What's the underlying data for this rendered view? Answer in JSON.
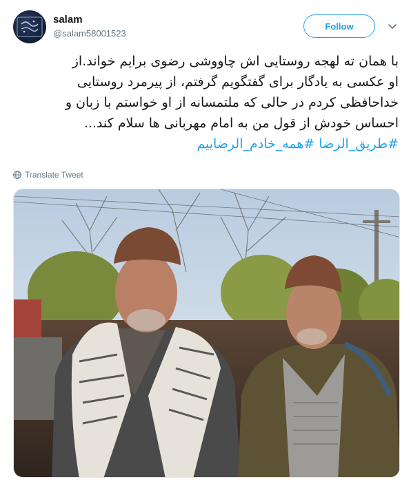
{
  "user": {
    "display_name": "salam",
    "handle": "@salam58001523"
  },
  "actions": {
    "follow_label": "Follow"
  },
  "tweet": {
    "lines": [
      "با همان ته لهجه روستایی اش چاووشی رضوی برایم خواند.از",
      "او عکسی به یادگار برای گفتگویم گرفتم، از پیرمرد روستایی",
      "خداحافظی کردم در حالی که ملتمسانه از او خواستم با زبان و",
      "احساس خودش از قول من به امام مهربانی ها سلام کند..."
    ],
    "hashtags": [
      "#طریق_الرضا",
      "#همه_خادم_الرضاییم"
    ]
  },
  "translate_label": "Translate Tweet",
  "colors": {
    "accent": "#1da1f2",
    "secondary_text": "#657786",
    "border": "#e1e8ed"
  },
  "icons": {
    "globe": "globe-icon",
    "caret": "chevron-down-icon"
  }
}
